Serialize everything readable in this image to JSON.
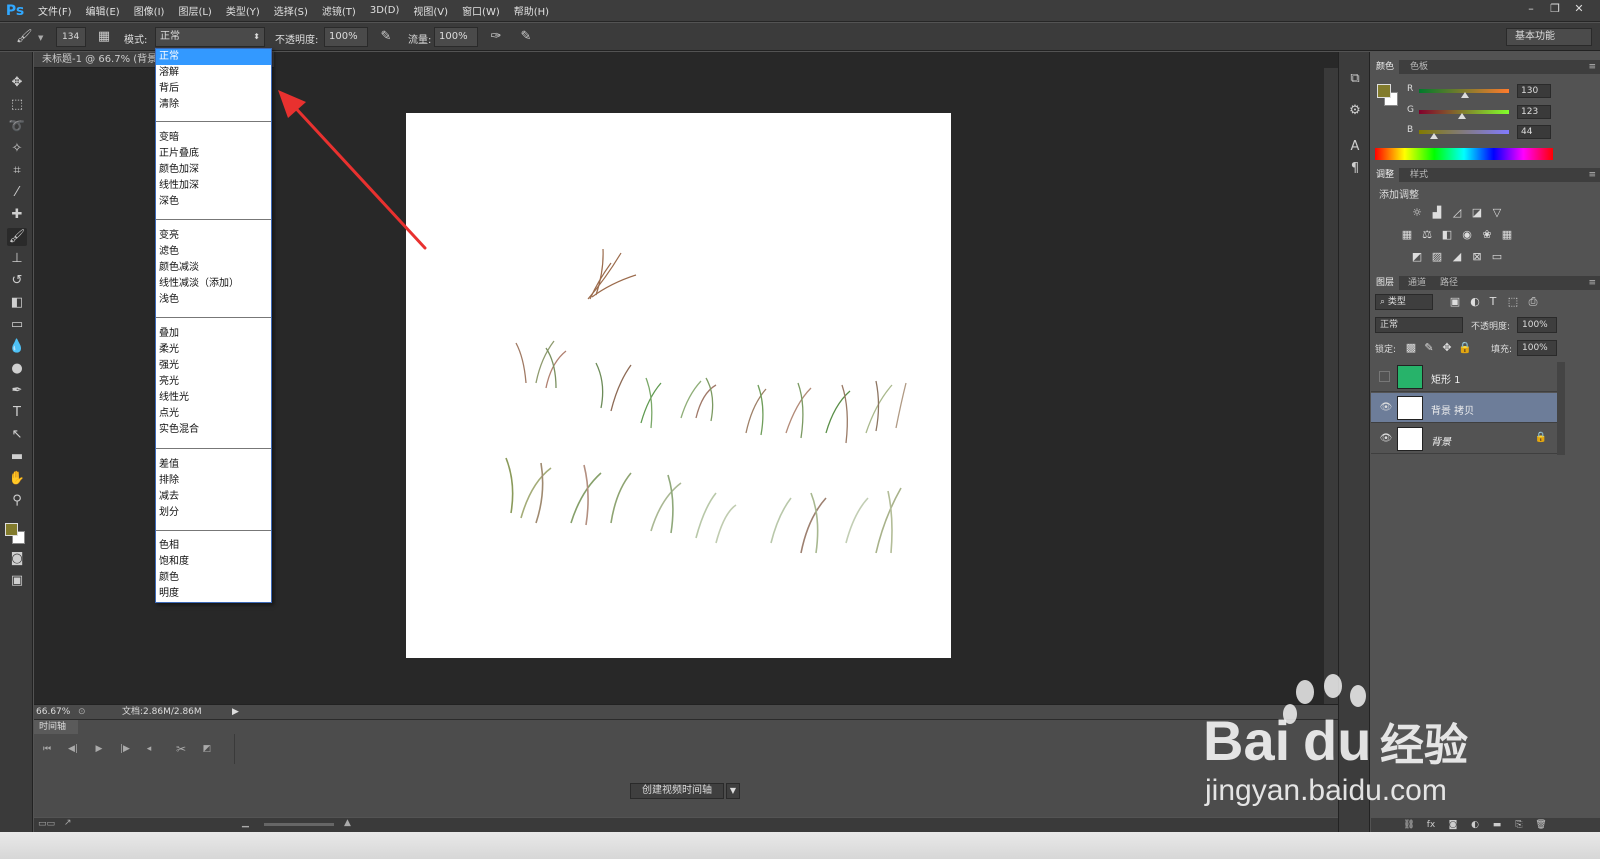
{
  "app": {
    "logo": "Ps"
  },
  "menubar": {
    "items": [
      "文件(F)",
      "编辑(E)",
      "图像(I)",
      "图层(L)",
      "类型(Y)",
      "选择(S)",
      "滤镜(T)",
      "3D(D)",
      "视图(V)",
      "窗口(W)",
      "帮助(H)"
    ]
  },
  "window_controls": {
    "minimize": "–",
    "restore": "❐",
    "close": "✕"
  },
  "options_bar": {
    "brush_size": "134",
    "mode_label": "模式:",
    "mode_value": "正常",
    "opacity_label": "不透明度:",
    "opacity_value": "100%",
    "flow_label": "流量:",
    "flow_value": "100%",
    "workspace": "基本功能"
  },
  "document": {
    "tab_title": "未标题-1 @ 66.7% (背景",
    "zoom": "66.67%",
    "doc_size": "文档:2.86M/2.86M"
  },
  "blend_modes": {
    "groups": [
      [
        "正常",
        "溶解",
        "背后",
        "清除"
      ],
      [
        "变暗",
        "正片叠底",
        "颜色加深",
        "线性加深",
        "深色"
      ],
      [
        "变亮",
        "滤色",
        "颜色减淡",
        "线性减淡（添加）",
        "浅色"
      ],
      [
        "叠加",
        "柔光",
        "强光",
        "亮光",
        "线性光",
        "点光",
        "实色混合"
      ],
      [
        "差值",
        "排除",
        "减去",
        "划分"
      ],
      [
        "色相",
        "饱和度",
        "颜色",
        "明度"
      ]
    ],
    "selected": "正常"
  },
  "timeline": {
    "tab": "时间轴",
    "create_button": "创建视频时间轴"
  },
  "color_panel": {
    "tabs": [
      "颜色",
      "色板"
    ],
    "r_label": "R",
    "r_value": "130",
    "g_label": "G",
    "g_value": "123",
    "b_label": "B",
    "b_value": "44",
    "fg_color": "#827b2c",
    "r_fraction": 0.51,
    "g_fraction": 0.48,
    "b_fraction": 0.17
  },
  "adjustments_panel": {
    "tabs": [
      "调整",
      "样式"
    ],
    "title": "添加调整"
  },
  "layers_panel": {
    "tabs": [
      "图层",
      "通道",
      "路径"
    ],
    "filter_label": "类型",
    "blend_mode": "正常",
    "opacity_label": "不透明度:",
    "opacity_value": "100%",
    "lock_label": "锁定:",
    "fill_label": "填充:",
    "fill_value": "100%",
    "layers": [
      {
        "name": "矩形 1",
        "visible": false,
        "thumb_color": "#27b36a"
      },
      {
        "name": "背景 拷贝",
        "visible": true,
        "selected": true
      },
      {
        "name": "背景",
        "visible": true,
        "locked": true
      }
    ]
  },
  "watermark": {
    "brand": "Bai",
    "brand_suffix": "经验",
    "url": "jingyan.baidu.com"
  },
  "colors": {
    "selection_blue": "#3399ff",
    "arrow_red": "#e8312f",
    "layer_selected": "#6d7d99"
  }
}
